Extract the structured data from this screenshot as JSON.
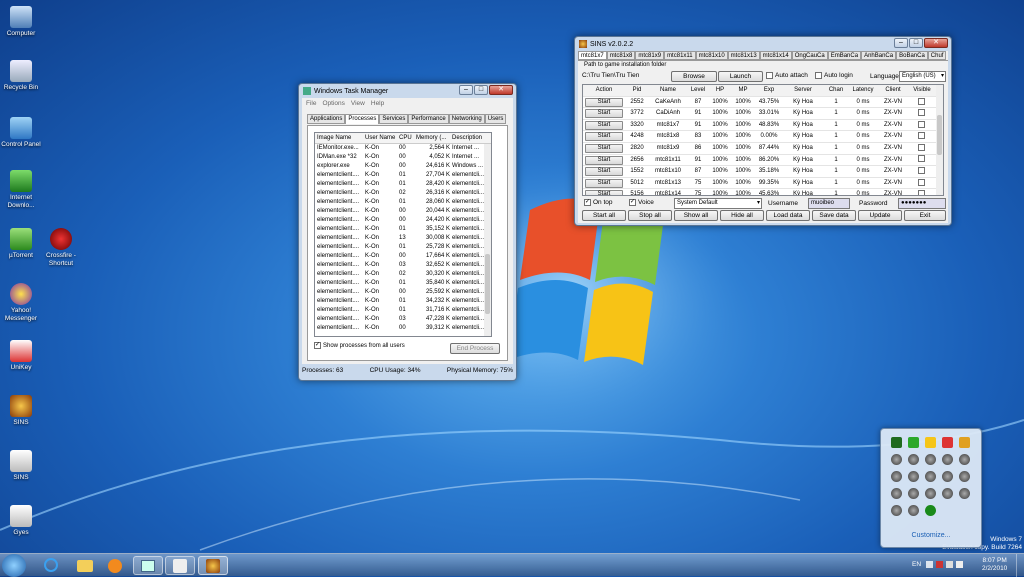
{
  "desktop": {
    "icons": [
      {
        "label": "Computer"
      },
      {
        "label": "Recycle Bin"
      },
      {
        "label": "Control Panel"
      },
      {
        "label": "Internet Downlo..."
      },
      {
        "label": "µTorrent"
      },
      {
        "label": "Crossfire - Shortcut"
      },
      {
        "label": "Yahoo! Messenger"
      },
      {
        "label": "UniKey"
      },
      {
        "label": "SINS"
      },
      {
        "label": "SINS"
      },
      {
        "label": "Gyes"
      }
    ],
    "watermark": {
      "line1": "Windows 7",
      "line2": "Evaluation copy. Build 7264"
    }
  },
  "taskmgr": {
    "title": "Windows Task Manager",
    "menu": [
      "File",
      "Options",
      "View",
      "Help"
    ],
    "tabs": [
      "Applications",
      "Processes",
      "Services",
      "Performance",
      "Networking",
      "Users"
    ],
    "columns": [
      "Image Name",
      "User Name",
      "CPU",
      "Memory (...",
      "Description"
    ],
    "rows": [
      [
        "IEMonitor.exe...",
        "K-On",
        "00",
        "2,564 K",
        "Internet ..."
      ],
      [
        "IDMan.exe *32",
        "K-On",
        "00",
        "4,052 K",
        "Internet ..."
      ],
      [
        "explorer.exe",
        "K-On",
        "00",
        "24,616 K",
        "Windows ..."
      ],
      [
        "elementclient....",
        "K-On",
        "01",
        "27,704 K",
        "elementcli..."
      ],
      [
        "elementclient....",
        "K-On",
        "01",
        "28,420 K",
        "elementcli..."
      ],
      [
        "elementclient....",
        "K-On",
        "02",
        "26,316 K",
        "elementcli..."
      ],
      [
        "elementclient....",
        "K-On",
        "01",
        "28,060 K",
        "elementcli..."
      ],
      [
        "elementclient....",
        "K-On",
        "00",
        "20,044 K",
        "elementcli..."
      ],
      [
        "elementclient....",
        "K-On",
        "00",
        "24,420 K",
        "elementcli..."
      ],
      [
        "elementclient....",
        "K-On",
        "01",
        "35,152 K",
        "elementcli..."
      ],
      [
        "elementclient....",
        "K-On",
        "13",
        "30,008 K",
        "elementcli..."
      ],
      [
        "elementclient....",
        "K-On",
        "01",
        "25,728 K",
        "elementcli..."
      ],
      [
        "elementclient....",
        "K-On",
        "00",
        "17,664 K",
        "elementcli..."
      ],
      [
        "elementclient....",
        "K-On",
        "03",
        "32,652 K",
        "elementcli..."
      ],
      [
        "elementclient....",
        "K-On",
        "02",
        "30,320 K",
        "elementcli..."
      ],
      [
        "elementclient....",
        "K-On",
        "01",
        "35,840 K",
        "elementcli..."
      ],
      [
        "elementclient....",
        "K-On",
        "00",
        "25,592 K",
        "elementcli..."
      ],
      [
        "elementclient....",
        "K-On",
        "01",
        "34,232 K",
        "elementcli..."
      ],
      [
        "elementclient....",
        "K-On",
        "01",
        "31,716 K",
        "elementcli..."
      ],
      [
        "elementclient....",
        "K-On",
        "03",
        "47,228 K",
        "elementcli..."
      ],
      [
        "elementclient....",
        "K-On",
        "00",
        "39,312 K",
        "elementcli..."
      ]
    ],
    "show_all": "Show processes from all users",
    "end_process": "End Process",
    "status": {
      "processes": "Processes: 63",
      "cpu": "CPU Usage: 34%",
      "memory": "Physical Memory: 75%"
    }
  },
  "sins": {
    "title": "SINS v2.0.2.2",
    "tabs": [
      "mtc81x7",
      "mtc81x8",
      "mtc81x9",
      "mtc81x11",
      "mtc81x10",
      "mtc81x13",
      "mtc81x14",
      "OngCauCa",
      "EmBanCa",
      "AnhBanCa",
      "BoBanCa",
      "Chuf"
    ],
    "path_label": "Path to game installation folder",
    "path_value": "C:\\Tru Tien\\Tru Tien",
    "browse": "Browse",
    "launch": "Launch",
    "auto_attach": "Auto attach",
    "auto_login": "Auto login",
    "language_label": "Language",
    "language_value": "English (US)",
    "columns": [
      "Action",
      "Pid",
      "Name",
      "Level",
      "HP",
      "MP",
      "Exp",
      "Server",
      "Chan",
      "Latency",
      "Client",
      "Visible"
    ],
    "rows": [
      [
        "Start",
        "2552",
        "CaKeAnh",
        "87",
        "100%",
        "100%",
        "43.75%",
        "Kỳ Hoa",
        "1",
        "0 ms",
        "ZX-VN"
      ],
      [
        "Start",
        "3772",
        "CaDiAnh",
        "91",
        "100%",
        "100%",
        "33.01%",
        "Kỳ Hoa",
        "1",
        "0 ms",
        "ZX-VN"
      ],
      [
        "Start",
        "3320",
        "mtc81x7",
        "91",
        "100%",
        "100%",
        "48.83%",
        "Kỳ Hoa",
        "1",
        "0 ms",
        "ZX-VN"
      ],
      [
        "Start",
        "4248",
        "mtc81x8",
        "83",
        "100%",
        "100%",
        "0.00%",
        "Kỳ Hoa",
        "1",
        "0 ms",
        "ZX-VN"
      ],
      [
        "Start",
        "2820",
        "mtc81x9",
        "86",
        "100%",
        "100%",
        "87.44%",
        "Kỳ Hoa",
        "1",
        "0 ms",
        "ZX-VN"
      ],
      [
        "Start",
        "2656",
        "mtc81x11",
        "91",
        "100%",
        "100%",
        "86.20%",
        "Kỳ Hoa",
        "1",
        "0 ms",
        "ZX-VN"
      ],
      [
        "Start",
        "1552",
        "mtc81x10",
        "87",
        "100%",
        "100%",
        "35.18%",
        "Kỳ Hoa",
        "1",
        "0 ms",
        "ZX-VN"
      ],
      [
        "Start",
        "5012",
        "mtc81x13",
        "75",
        "100%",
        "100%",
        "99.35%",
        "Kỳ Hoa",
        "1",
        "0 ms",
        "ZX-VN"
      ],
      [
        "Start",
        "5156",
        "mtc81x14",
        "75",
        "100%",
        "100%",
        "45.63%",
        "Kỳ Hoa",
        "1",
        "0 ms",
        "ZX-VN"
      ]
    ],
    "on_top": "On top",
    "voice": "Voice",
    "audio_device": "System Default",
    "username_label": "Username",
    "username_value": "muoibeo",
    "password_label": "Password",
    "password_value": "●●●●●●●",
    "buttons": [
      "Start all",
      "Stop all",
      "Show all",
      "Hide all",
      "Load data",
      "Save data",
      "Update",
      "Exit"
    ]
  },
  "tray_popup": {
    "customize": "Customize..."
  },
  "taskbar": {
    "lang": "EN",
    "time": "8:07 PM",
    "date": "2/2/2010"
  }
}
